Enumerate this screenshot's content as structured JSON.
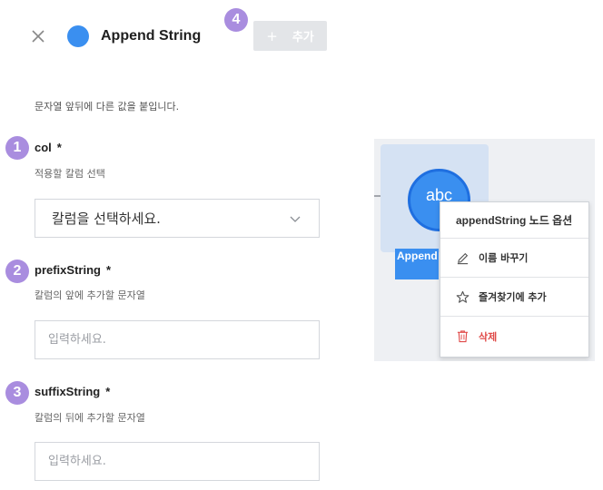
{
  "header": {
    "node_title": "Append String",
    "add_button_label": "추가",
    "node_color": "#3a8ff0"
  },
  "description": "문자열 앞뒤에 다른 값을 붙입니다.",
  "badges": {
    "b1": "1",
    "b2": "2",
    "b3": "3",
    "b4": "4"
  },
  "fields": {
    "col": {
      "label": "col",
      "required_mark": "*",
      "help": "적용할 칼럼 선택",
      "selected_value": "칼럼을 선택하세요."
    },
    "prefix": {
      "label": "prefixString",
      "required_mark": "*",
      "help": "칼럼의 앞에 추가할 문자열",
      "placeholder": "입력하세요.",
      "value": ""
    },
    "suffix": {
      "label": "suffixString",
      "required_mark": "*",
      "help": "칼럼의 뒤에 추가할 문자열",
      "placeholder": "입력하세요.",
      "value": ""
    }
  },
  "preview": {
    "node_icon_text": "abc",
    "node_name": "Append",
    "context_menu": {
      "title": "appendString 노드 옵션",
      "items": [
        {
          "label": "이름 바꾸기",
          "icon": "pencil-icon"
        },
        {
          "label": "즐겨찾기에 추가",
          "icon": "star-icon"
        },
        {
          "label": "삭제",
          "icon": "trash-icon"
        }
      ]
    }
  },
  "colors": {
    "accent": "#3a8ff0",
    "badge": "#a98ddf",
    "danger": "#e04a48"
  }
}
